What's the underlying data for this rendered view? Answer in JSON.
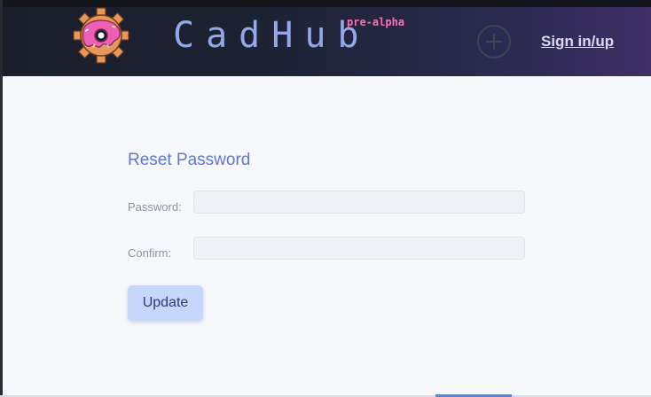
{
  "header": {
    "brand": "CadHub",
    "badge": "pre-alpha",
    "signin_label": "Sign in/up"
  },
  "form": {
    "title": "Reset Password",
    "password_label": "Password:",
    "password_value": "",
    "confirm_label": "Confirm:",
    "confirm_value": "",
    "submit_label": "Update"
  },
  "colors": {
    "brand": "#93a8ea",
    "badge": "#f472b6",
    "title": "#5f78d3",
    "button_bg": "#c7d6fb"
  },
  "icons": {
    "logo": "donut-gear-logo",
    "add": "plus-circle-icon"
  }
}
